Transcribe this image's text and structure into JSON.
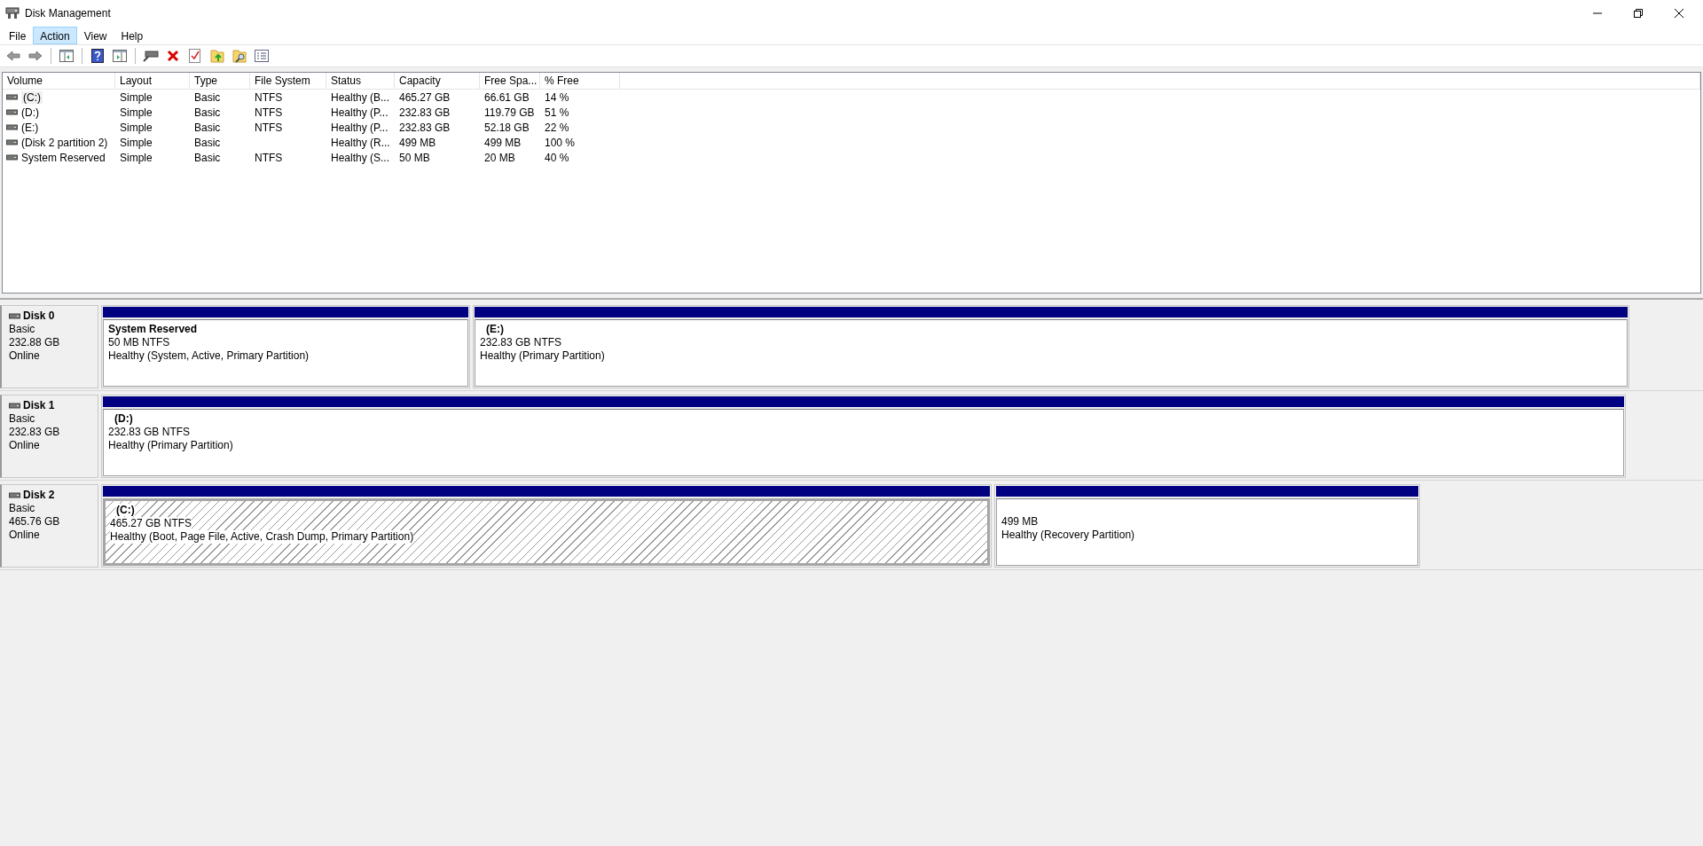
{
  "window": {
    "title": "Disk Management"
  },
  "menu": [
    {
      "label": "File",
      "selected": false
    },
    {
      "label": "Action",
      "selected": true
    },
    {
      "label": "View",
      "selected": false
    },
    {
      "label": "Help",
      "selected": false
    }
  ],
  "table": {
    "columns": [
      "Volume",
      "Layout",
      "Type",
      "File System",
      "Status",
      "Capacity",
      "Free Spa...",
      "% Free"
    ],
    "rows": [
      {
        "selected": true,
        "cells": [
          "(C:)",
          "Simple",
          "Basic",
          "NTFS",
          "Healthy (B...",
          "465.27 GB",
          "66.61 GB",
          "14 %"
        ]
      },
      {
        "selected": false,
        "cells": [
          "(D:)",
          "Simple",
          "Basic",
          "NTFS",
          "Healthy (P...",
          "232.83 GB",
          "119.79 GB",
          "51 %"
        ]
      },
      {
        "selected": false,
        "cells": [
          "(E:)",
          "Simple",
          "Basic",
          "NTFS",
          "Healthy (P...",
          "232.83 GB",
          "52.18 GB",
          "22 %"
        ]
      },
      {
        "selected": false,
        "cells": [
          "(Disk 2 partition 2)",
          "Simple",
          "Basic",
          "",
          "Healthy (R...",
          "499 MB",
          "499 MB",
          "100 %"
        ]
      },
      {
        "selected": false,
        "cells": [
          "System Reserved",
          "Simple",
          "Basic",
          "NTFS",
          "Healthy (S...",
          "50 MB",
          "20 MB",
          "40 %"
        ]
      }
    ]
  },
  "disks": [
    {
      "name": "Disk 0",
      "type": "Basic",
      "size": "232.88 GB",
      "status": "Online",
      "partitions": [
        {
          "name": "System Reserved",
          "size": "50 MB NTFS",
          "status": "Healthy (System, Active, Primary Partition)",
          "selected": false
        },
        {
          "name": "(E:)",
          "size": "232.83 GB NTFS",
          "status": "Healthy (Primary Partition)",
          "selected": false
        }
      ]
    },
    {
      "name": "Disk 1",
      "type": "Basic",
      "size": "232.83 GB",
      "status": "Online",
      "partitions": [
        {
          "name": "(D:)",
          "size": "232.83 GB NTFS",
          "status": "Healthy (Primary Partition)",
          "selected": false
        }
      ]
    },
    {
      "name": "Disk 2",
      "type": "Basic",
      "size": "465.76 GB",
      "status": "Online",
      "partitions": [
        {
          "name": "(C:)",
          "size": "465.27 GB NTFS",
          "status": "Healthy (Boot, Page File, Active, Crash Dump, Primary Partition)",
          "selected": true
        },
        {
          "size": "499 MB",
          "status": "Healthy (Recovery Partition)",
          "selected": false
        }
      ]
    }
  ]
}
